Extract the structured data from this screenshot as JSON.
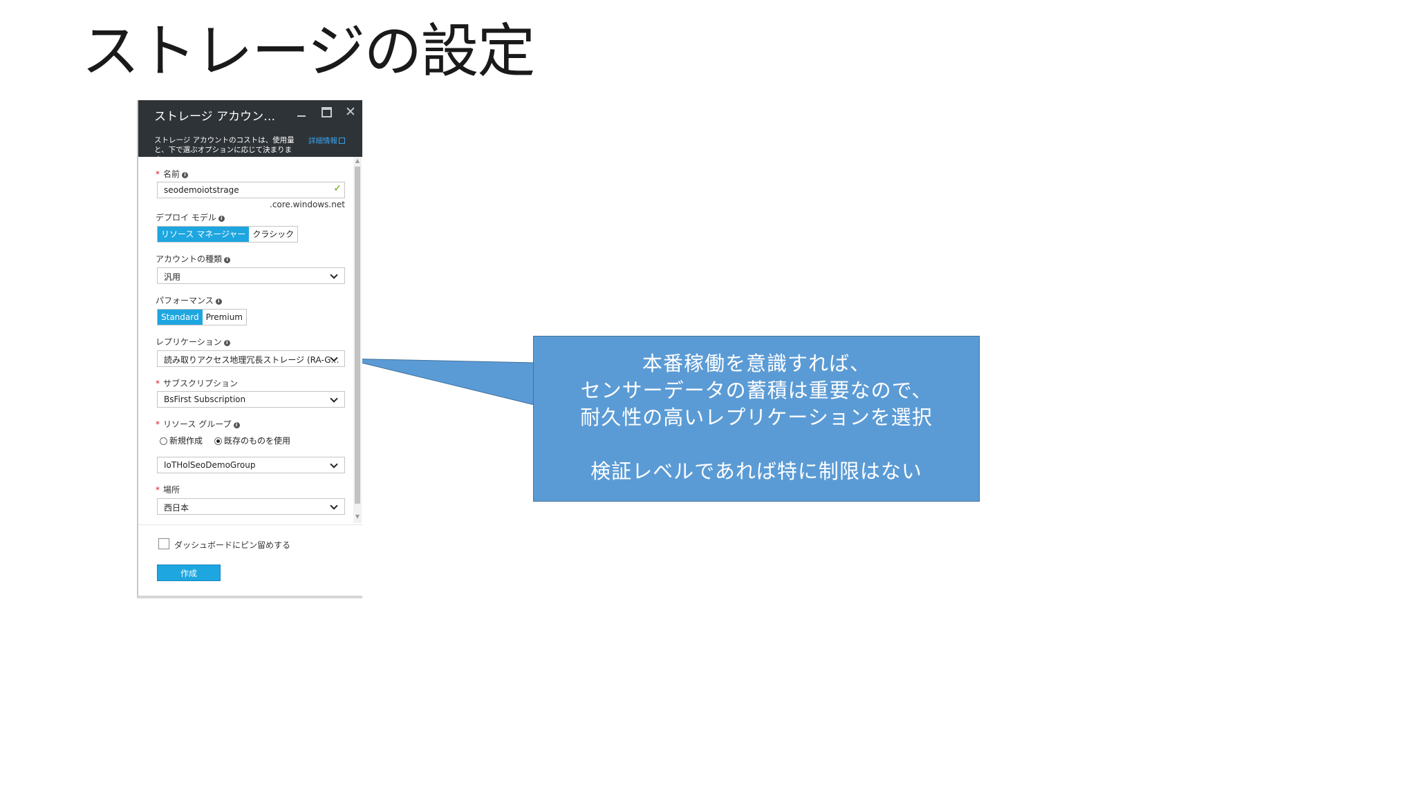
{
  "slide": {
    "title": "ストレージの設定"
  },
  "blade": {
    "title": "ストレージ アカウン…",
    "description": "ストレージ アカウントのコストは、使用量と、下で選ぶオプションに応じて決まります。",
    "details_link": "詳細情報",
    "icons": {
      "minimize": "minimize-icon",
      "maximize": "maximize-icon",
      "close": "close-icon"
    }
  },
  "form": {
    "name": {
      "label": "名前",
      "value": "seodemoiotstrage",
      "suffix": ".core.windows.net",
      "required": true
    },
    "deployment_model": {
      "label": "デプロイ モデル",
      "options": [
        "リソース マネージャー",
        "クラシック"
      ],
      "selected": "リソース マネージャー"
    },
    "account_kind": {
      "label": "アカウントの種類",
      "value": "汎用"
    },
    "performance": {
      "label": "パフォーマンス",
      "options": [
        "Standard",
        "Premium"
      ],
      "selected": "Standard"
    },
    "replication": {
      "label": "レプリケーション",
      "value": "読み取りアクセス地理冗長ストレージ (RA-G…"
    },
    "subscription": {
      "label": "サブスクリプション",
      "value": "BsFirst Subscription",
      "required": true
    },
    "resource_group": {
      "label": "リソース グループ",
      "required": true,
      "radio_new": "新規作成",
      "radio_existing": "既存のものを使用",
      "selected": "既存のものを使用",
      "value": "IoTHolSeoDemoGroup"
    },
    "location": {
      "label": "場所",
      "value": "西日本",
      "required": true
    }
  },
  "footer": {
    "pin_label": "ダッシュボードにピン留めする",
    "pin_checked": false,
    "create_label": "作成"
  },
  "callout": {
    "lines": [
      "本番稼働を意識すれば、",
      "センサーデータの蓄積は重要なので、",
      "耐久性の高いレプリケーションを選択",
      "",
      "検証レベルであれば特に制限はない"
    ]
  },
  "colors": {
    "accent": "#1ea6e0",
    "callout": "#5b9bd5",
    "header": "#2e3337",
    "required": "#e81123"
  }
}
